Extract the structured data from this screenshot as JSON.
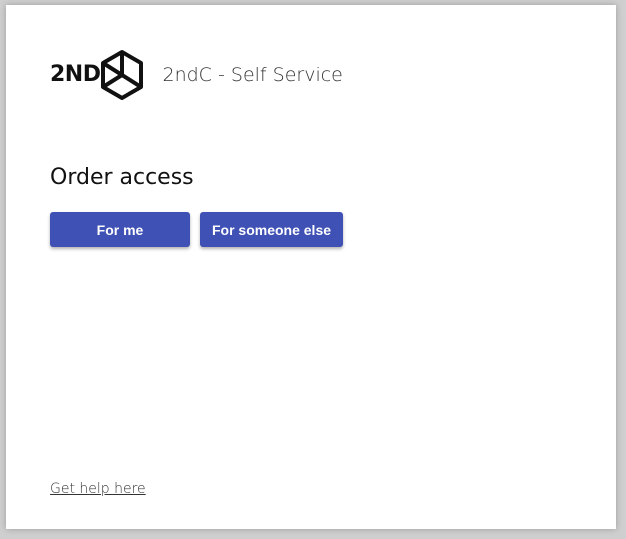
{
  "brand": {
    "logo_text": "2ND",
    "logo_icon": "cube-outline-icon",
    "title": "2ndC - Self Service"
  },
  "main": {
    "heading": "Order access",
    "buttons": {
      "for_me": "For me",
      "for_someone_else": "For someone else"
    }
  },
  "footer": {
    "help_link": "Get help here"
  },
  "colors": {
    "primary_button": "#3f51b5",
    "background": "#ffffff"
  }
}
